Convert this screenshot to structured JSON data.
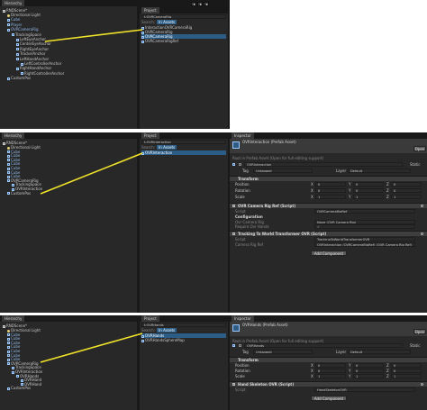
{
  "panel1": {
    "hierarchy": {
      "tab": "Hierarchy",
      "scene": "RNDScene*",
      "items": [
        {
          "label": "Directional Light",
          "indent": 1,
          "type": "light",
          "selected": false,
          "blue": false
        },
        {
          "label": "Cube",
          "indent": 1,
          "type": "cube",
          "selected": false,
          "blue": true
        },
        {
          "label": "Player",
          "indent": 1,
          "type": "cube",
          "selected": false,
          "blue": true
        },
        {
          "label": "OVRCameraRig",
          "indent": 1,
          "type": "cube",
          "selected": false,
          "blue": true
        },
        {
          "label": "TrackingSpace",
          "indent": 2,
          "type": "cube",
          "selected": false,
          "blue": false
        },
        {
          "label": "LeftEyeAnchor",
          "indent": 3,
          "type": "cube",
          "selected": false,
          "blue": false
        },
        {
          "label": "CenterEyeAnchor",
          "indent": 3,
          "type": "cube",
          "selected": false,
          "blue": false
        },
        {
          "label": "RightEyeAnchor",
          "indent": 3,
          "type": "cube",
          "selected": false,
          "blue": false
        },
        {
          "label": "TrackerAnchor",
          "indent": 3,
          "type": "cube",
          "selected": false,
          "blue": false
        },
        {
          "label": "LeftHandAnchor",
          "indent": 3,
          "type": "cube",
          "selected": false,
          "blue": false
        },
        {
          "label": "LeftControllerAnchor",
          "indent": 4,
          "type": "cube",
          "selected": false,
          "blue": false
        },
        {
          "label": "RightHandAnchor",
          "indent": 3,
          "type": "cube",
          "selected": false,
          "blue": false
        },
        {
          "label": "RightControllerAnchor",
          "indent": 4,
          "type": "cube",
          "selected": false,
          "blue": false
        },
        {
          "label": "CustomPos",
          "indent": 1,
          "type": "cube",
          "selected": false,
          "blue": false
        }
      ]
    },
    "project": {
      "tab": "Project",
      "search_label": "Search:",
      "search_scope": "In Assets",
      "search_query": "t:OVRCameraRig",
      "results": [
        {
          "label": "InteractionOVRCameraRig",
          "selected": false
        },
        {
          "label": "OVRCameraRig",
          "selected": false
        },
        {
          "label": "OVRCameraRig",
          "selected": true
        },
        {
          "label": "OVRCameraRigRef",
          "selected": false
        }
      ]
    }
  },
  "panel2": {
    "hierarchy": {
      "tab": "Hierarchy",
      "scene": "RNDScene*",
      "items": [
        {
          "label": "Directional Light",
          "indent": 1,
          "type": "light",
          "blue": false
        },
        {
          "label": "Cube",
          "indent": 1,
          "type": "cube",
          "blue": true
        },
        {
          "label": "Cube",
          "indent": 1,
          "type": "cube",
          "blue": true
        },
        {
          "label": "Cube",
          "indent": 1,
          "type": "cube",
          "blue": true
        },
        {
          "label": "Cube",
          "indent": 1,
          "type": "cube",
          "blue": true
        },
        {
          "label": "Cube",
          "indent": 1,
          "type": "cube",
          "blue": true
        },
        {
          "label": "Cube",
          "indent": 1,
          "type": "cube",
          "blue": true
        },
        {
          "label": "Cube",
          "indent": 1,
          "type": "cube",
          "blue": true
        },
        {
          "label": "OVRCameraRig",
          "indent": 1,
          "type": "cube",
          "blue": false
        },
        {
          "label": "TrackingSpace",
          "indent": 2,
          "type": "cube",
          "blue": false
        },
        {
          "label": "OVRInteraction",
          "indent": 2,
          "type": "cube",
          "blue": false
        },
        {
          "label": "CustomPos",
          "indent": 1,
          "type": "cube",
          "blue": false
        }
      ]
    },
    "project": {
      "tab": "Project",
      "search_label": "Search:",
      "search_scope": "In Assets",
      "search_query": "t:OVRInteraction",
      "results": [
        {
          "label": "OVRInteraction",
          "selected": true
        }
      ]
    },
    "inspector": {
      "tab": "Inspector",
      "title": "OVRInteraction (Prefab Asset)",
      "open_button": "Open",
      "root_note": "Root in Prefab Asset (Open for full editing support)",
      "static_label": "Static",
      "name_value": "OVRInteraction",
      "tag_label": "Tag",
      "tag_value": "Untagged",
      "layer_label": "Layer",
      "layer_value": "Default",
      "transform_header": "Transform",
      "transform_rows": [
        {
          "label": "Position",
          "x": "0",
          "y": "0",
          "z": "0"
        },
        {
          "label": "Rotation",
          "x": "0",
          "y": "0",
          "z": "0"
        },
        {
          "label": "Scale",
          "x": "1",
          "y": "1",
          "z": "1"
        }
      ],
      "components": [
        {
          "header": "OVR Camera Rig Ref (Script)",
          "fields": [
            {
              "label": "Script",
              "value": "OVRCameraRigRef"
            },
            {
              "label": "Configuration",
              "value": ""
            },
            {
              "label": "Ovr Camera Rig",
              "value": "None (OVR Camera Rig)"
            },
            {
              "label": "Require Ovr Hands",
              "value": "✓"
            }
          ]
        },
        {
          "header": "Tracking To World Transformer OVR (Script)",
          "fields": [
            {
              "label": "Script",
              "value": "TrackingToWorldTransformerOVR"
            },
            {
              "label": "Camera Rig Ref",
              "value": "OVRInteraction (OVRCameraRigRef) (OVR Camera Rig Ref)"
            }
          ]
        }
      ],
      "add_component": "Add Component"
    }
  },
  "panel3": {
    "hierarchy": {
      "tab": "Hierarchy",
      "scene": "RNDScene*",
      "items": [
        {
          "label": "Directional Light",
          "indent": 1,
          "type": "light",
          "blue": false
        },
        {
          "label": "Cube",
          "indent": 1,
          "type": "cube",
          "blue": true
        },
        {
          "label": "Cube",
          "indent": 1,
          "type": "cube",
          "blue": true
        },
        {
          "label": "Cube",
          "indent": 1,
          "type": "cube",
          "blue": true
        },
        {
          "label": "Cube",
          "indent": 1,
          "type": "cube",
          "blue": true
        },
        {
          "label": "Cube",
          "indent": 1,
          "type": "cube",
          "blue": true
        },
        {
          "label": "Cube",
          "indent": 1,
          "type": "cube",
          "blue": true
        },
        {
          "label": "Cube",
          "indent": 1,
          "type": "cube",
          "blue": true
        },
        {
          "label": "OVRCameraRig",
          "indent": 1,
          "type": "cube",
          "blue": false
        },
        {
          "label": "TrackingSpace",
          "indent": 2,
          "type": "cube",
          "blue": false
        },
        {
          "label": "OVRInteraction",
          "indent": 2,
          "type": "cube",
          "blue": false
        },
        {
          "label": "OVRHands",
          "indent": 3,
          "type": "cube",
          "blue": false
        },
        {
          "label": "OVRHand",
          "indent": 4,
          "type": "cube",
          "blue": false
        },
        {
          "label": "OVRHand",
          "indent": 4,
          "type": "cube",
          "blue": false
        },
        {
          "label": "CustomPos",
          "indent": 1,
          "type": "cube",
          "blue": false
        }
      ]
    },
    "project": {
      "tab": "Project",
      "search_label": "Search:",
      "search_scope": "In Assets",
      "search_query": "t:OVRHands",
      "results": [
        {
          "label": "OVRHands",
          "selected": true
        },
        {
          "label": "OVRHandsSphereMap",
          "selected": false
        }
      ]
    },
    "inspector": {
      "tab": "Inspector",
      "title": "OVRHands (Prefab Asset)",
      "open_button": "Open",
      "root_note": "Root in Prefab Asset (Open for full editing support)",
      "static_label": "Static",
      "name_value": "OVRHands",
      "tag_label": "Tag",
      "tag_value": "Untagged",
      "layer_label": "Layer",
      "layer_value": "Default",
      "transform_header": "Transform",
      "transform_rows": [
        {
          "label": "Position",
          "x": "0",
          "y": "0",
          "z": "0"
        },
        {
          "label": "Rotation",
          "x": "0",
          "y": "0",
          "z": "0"
        },
        {
          "label": "Scale",
          "x": "1",
          "y": "1",
          "z": "1"
        }
      ],
      "components": [
        {
          "header": "Hand Skeleton OVR (Script)",
          "fields": [
            {
              "label": "Script",
              "value": "HandSkeletonOVR"
            }
          ]
        }
      ],
      "add_component": "Add Component"
    }
  },
  "colors": {
    "panel_bg": "#282828",
    "tabbar_bg": "#191919",
    "selection": "#2c5d87",
    "arrow": "#f1e32a",
    "prefab_blue": "#8fb8e8"
  },
  "icons": [
    "play-icon",
    "pause-icon",
    "step-icon",
    "scene-icon",
    "cube-icon",
    "light-icon",
    "script-icon",
    "gear-icon"
  ]
}
